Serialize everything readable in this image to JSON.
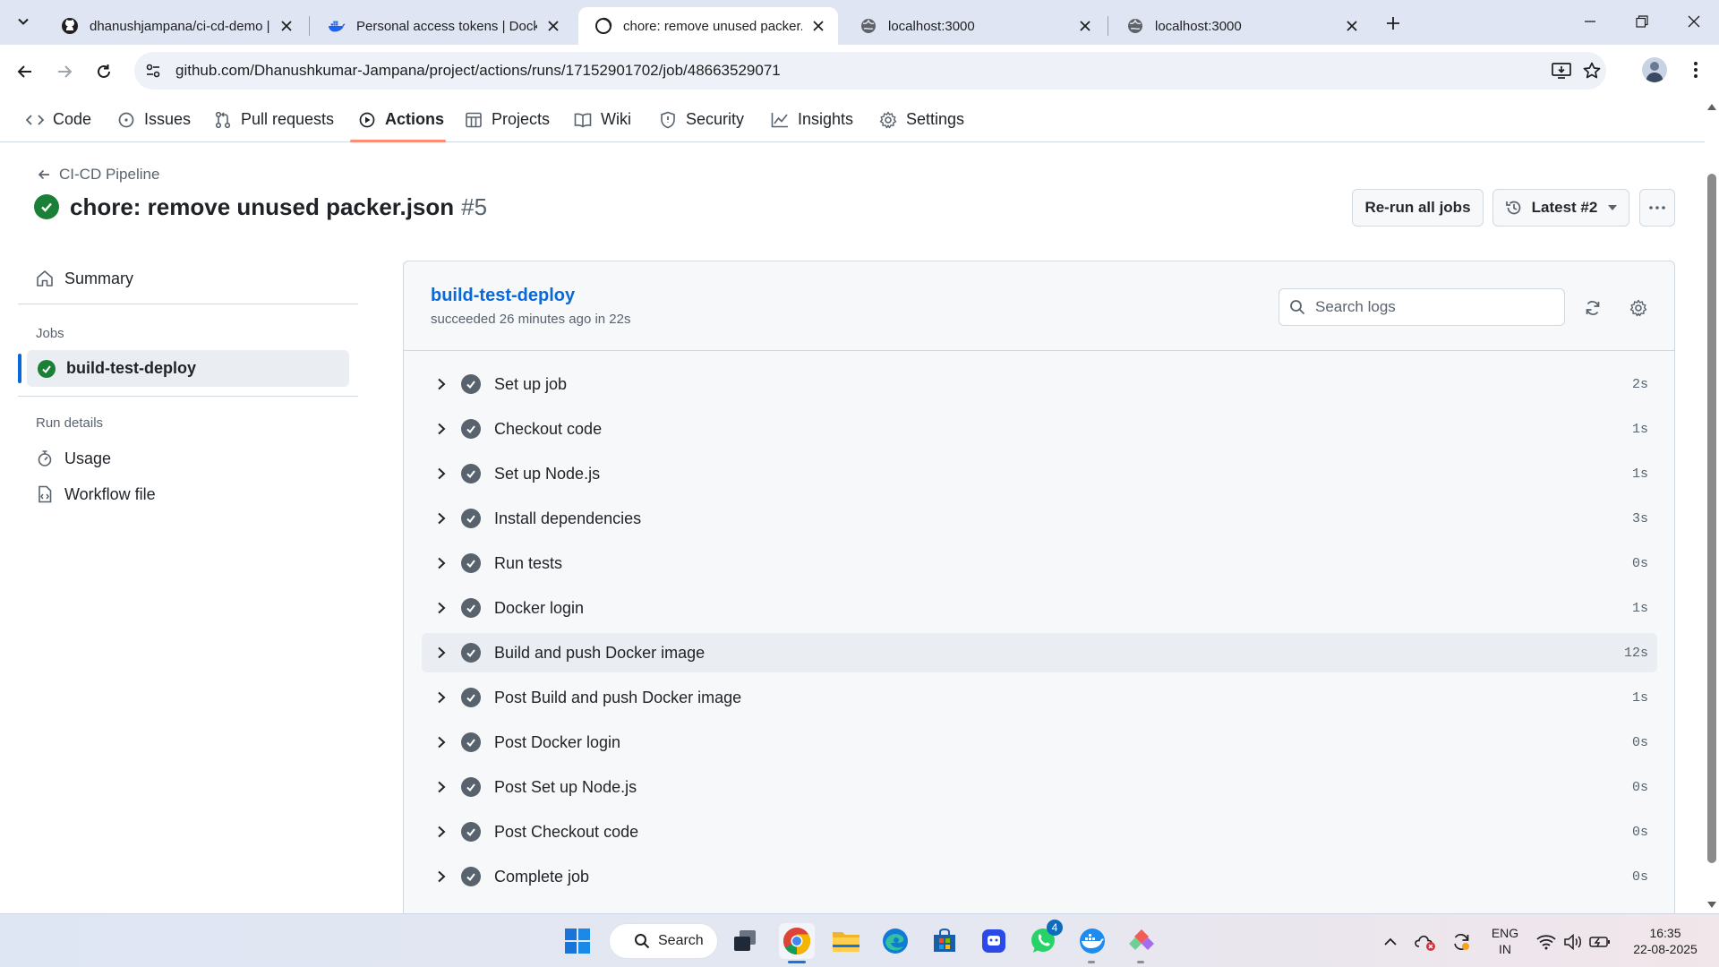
{
  "browser": {
    "tabs": [
      {
        "title": "dhanushjampana/ci-cd-demo |",
        "favicon": "github-icon"
      },
      {
        "title": "Personal access tokens | Docker",
        "favicon": "docker-icon"
      },
      {
        "title": "chore: remove unused packer.js",
        "favicon": "github-icon",
        "active": true
      },
      {
        "title": "localhost:3000",
        "favicon": "globe-icon"
      },
      {
        "title": "localhost:3000",
        "favicon": "globe-icon"
      }
    ],
    "url": "github.com/Dhanushkumar-Jampana/project/actions/runs/17152901702/job/48663529071"
  },
  "repo_nav": {
    "items": [
      {
        "label": "Code",
        "icon": "code-icon"
      },
      {
        "label": "Issues",
        "icon": "issue-icon"
      },
      {
        "label": "Pull requests",
        "icon": "pull-request-icon"
      },
      {
        "label": "Actions",
        "icon": "play-icon",
        "active": true
      },
      {
        "label": "Projects",
        "icon": "table-icon"
      },
      {
        "label": "Wiki",
        "icon": "book-icon"
      },
      {
        "label": "Security",
        "icon": "shield-icon"
      },
      {
        "label": "Insights",
        "icon": "graph-icon"
      },
      {
        "label": "Settings",
        "icon": "gear-icon"
      }
    ]
  },
  "header": {
    "back_link": "CI-CD Pipeline",
    "run_title": "chore: remove unused packer.json",
    "run_number": "#5",
    "rerun_label": "Re-run all jobs",
    "latest_label": "Latest #2"
  },
  "sidebar": {
    "summary": "Summary",
    "jobs_heading": "Jobs",
    "job": "build-test-deploy",
    "run_details_heading": "Run details",
    "usage": "Usage",
    "workflow_file": "Workflow file"
  },
  "job_panel": {
    "name": "build-test-deploy",
    "status": "succeeded 26 minutes ago in 22s",
    "search_placeholder": "Search logs",
    "steps": [
      {
        "label": "Set up job",
        "duration": "2s"
      },
      {
        "label": "Checkout code",
        "duration": "1s"
      },
      {
        "label": "Set up Node.js",
        "duration": "1s"
      },
      {
        "label": "Install dependencies",
        "duration": "3s"
      },
      {
        "label": "Run tests",
        "duration": "0s"
      },
      {
        "label": "Docker login",
        "duration": "1s"
      },
      {
        "label": "Build and push Docker image",
        "duration": "12s"
      },
      {
        "label": "Post Build and push Docker image",
        "duration": "1s"
      },
      {
        "label": "Post Docker login",
        "duration": "0s"
      },
      {
        "label": "Post Set up Node.js",
        "duration": "0s"
      },
      {
        "label": "Post Checkout code",
        "duration": "0s"
      },
      {
        "label": "Complete job",
        "duration": "0s"
      }
    ]
  },
  "taskbar": {
    "search_label": "Search",
    "whatsapp_badge": "4",
    "lang_line1": "ENG",
    "lang_line2": "IN",
    "time": "16:35",
    "date": "22-08-2025"
  },
  "colors": {
    "success": "#1a7f37",
    "link": "#0969da",
    "active_underline": "#fd8c73"
  }
}
